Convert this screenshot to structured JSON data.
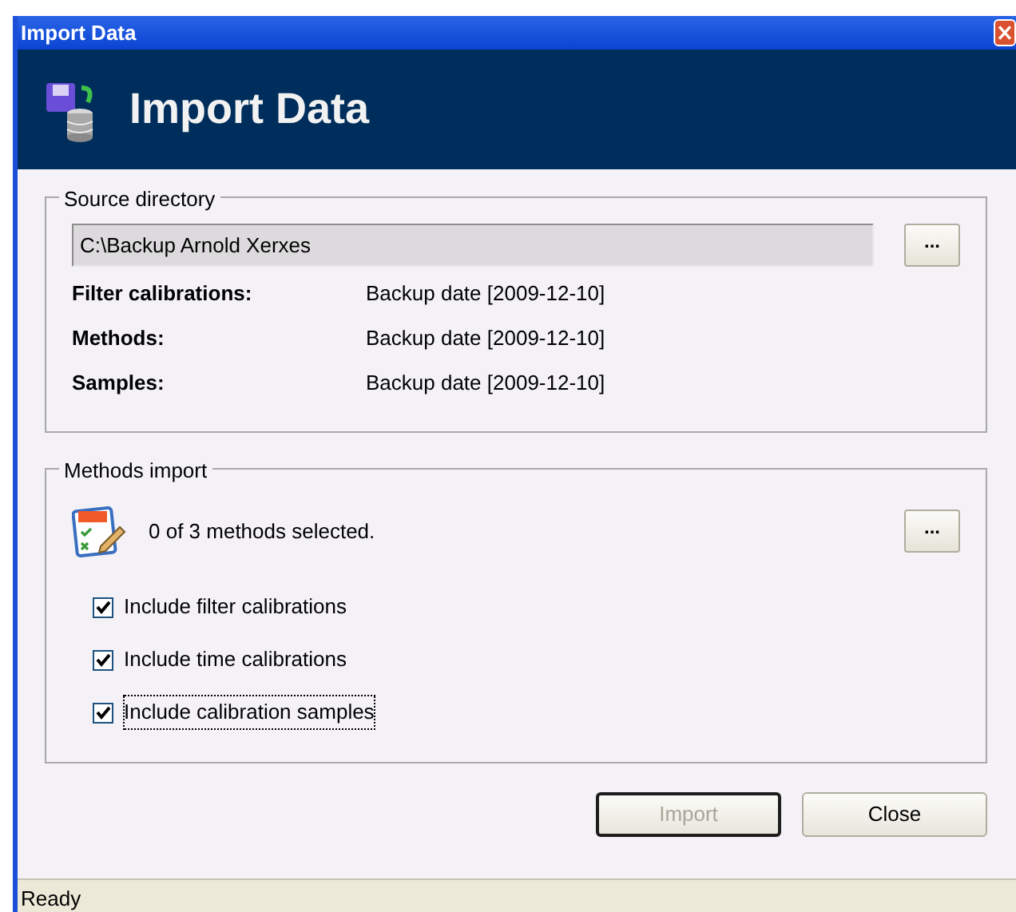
{
  "window": {
    "title": "Import Data"
  },
  "header": {
    "title": "Import Data"
  },
  "source_directory": {
    "legend": "Source directory",
    "path": "C:\\Backup Arnold Xerxes",
    "browse_button": "...",
    "rows": [
      {
        "label": "Filter calibrations:",
        "value": "Backup date [2009-12-10]"
      },
      {
        "label": "Methods:",
        "value": "Backup date [2009-12-10]"
      },
      {
        "label": "Samples:",
        "value": "Backup date [2009-12-10]"
      }
    ]
  },
  "methods_import": {
    "legend": "Methods import",
    "summary": "0 of 3 methods selected.",
    "browse_button": "...",
    "options": [
      {
        "label": "Include filter calibrations",
        "checked": true,
        "focused": false
      },
      {
        "label": "Include time calibrations",
        "checked": true,
        "focused": false
      },
      {
        "label": "Include calibration samples",
        "checked": true,
        "focused": true
      }
    ]
  },
  "buttons": [
    {
      "label": "Import",
      "disabled": true
    },
    {
      "label": "Close",
      "disabled": false
    }
  ],
  "status_bar": "Ready"
}
